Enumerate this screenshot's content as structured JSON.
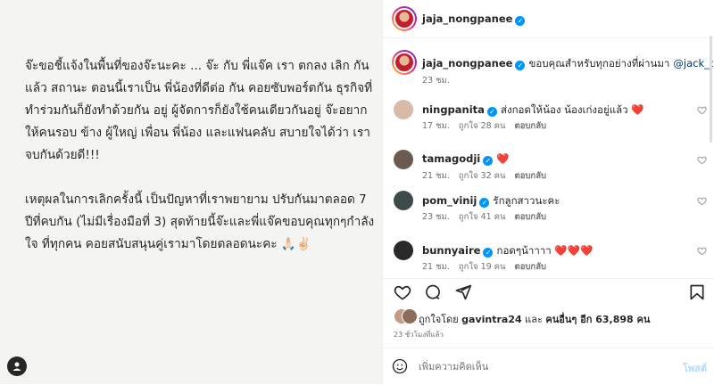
{
  "post_image": {
    "paragraphs": [
      "จ๊ะขอชี้แจ้งในพื้นที่ของจ๊ะนะคะ ... จ๊ะ กับ พี่แจ๊ค เรา ตกลง เลิก กันแล้ว สถานะ ตอนนี้เราเป็น พี่น้องที่ดีต่อ กัน คอยซับพอร์ตกัน ธุรกิจที่ทำร่วมกันก็ยังทำด้วยกัน อยู่ ผู้จัดการก็ยังใช้คนเดียวกันอยู่ จ๊ะอยากให้คนรอบ ข้าง ผู้ใหญ่ เพื่อน พี่น้อง และแฟนคลับ สบายใจได้ว่า เราจบกันด้วยดี!!!",
      "เหตุผลในการเลิกครั้งนี้ เป็นปัญหาที่เราพยายาม ปรับกันมาตลอด 7 ปีที่คบกัน (ไม่มีเรื่องมือที่ 3) สุดท้ายนี้จ๊ะและพี่แจ๊คขอบคุณทุกๆกำลังใจ ที่ทุกคน คอยสนับสนุนคู่เรามาโดยตลอดนะคะ 🙏🏻✌🏻"
    ]
  },
  "header": {
    "username": "jaja_nongpanee",
    "verified_glyph": "✓"
  },
  "caption": {
    "username": "jaja_nongpanee",
    "text": "ขอบคุณสำหรับทุกอย่างที่ผ่านมา",
    "mention": "@jack_tha",
    "emoji": "🙏🏻",
    "time": "23 ชม."
  },
  "comments": [
    {
      "username": "ningpanita",
      "verified": true,
      "text": "ส่งกอดให้น้อง น้องเก่งอยู่แล้ว ❤️",
      "time": "17 ชม.",
      "likes": "ถูกใจ 28 คน",
      "reply": "ตอบกลับ",
      "avatar_color": "#d9b9a8"
    },
    {
      "username": "tamagodji",
      "verified": true,
      "text": "❤️",
      "time": "21 ชม.",
      "likes": "ถูกใจ 32 คน",
      "reply": "ตอบกลับ",
      "avatar_color": "#6b5a4f"
    },
    {
      "username": "pom_vinij",
      "verified": true,
      "text": "รักลูกสาวนะคะ",
      "time": "23 ชม.",
      "likes": "ถูกใจ 41 คน",
      "reply": "ตอบกลับ",
      "avatar_color": "#3d4a4a"
    },
    {
      "username": "bunnyaire",
      "verified": true,
      "text": "กอดๆน้าาาา ❤️❤️❤️",
      "time": "21 ชม.",
      "likes": "ถูกใจ 19 คน",
      "reply": "ตอบกลับ",
      "avatar_color": "#2a2a2a"
    }
  ],
  "likes": {
    "prefix": "ถูกใจโดย",
    "user": "gavintra24",
    "middle": "และ",
    "others": "คนอื่นๆ อีก 63,898 คน"
  },
  "post_time": "23 ชั่วโมงที่แล้ว",
  "comment_box": {
    "placeholder": "เพิ่มความคิดเห็น",
    "post_label": "โพสต์"
  },
  "icons": [
    "heart-icon",
    "comment-icon",
    "share-icon",
    "bookmark-icon",
    "emoji-icon",
    "verified-icon",
    "ghost-icon"
  ],
  "colors": {
    "verified": "#0095f6",
    "heart": "#ed1c24",
    "mention": "#00376b",
    "muted": "#737373"
  }
}
